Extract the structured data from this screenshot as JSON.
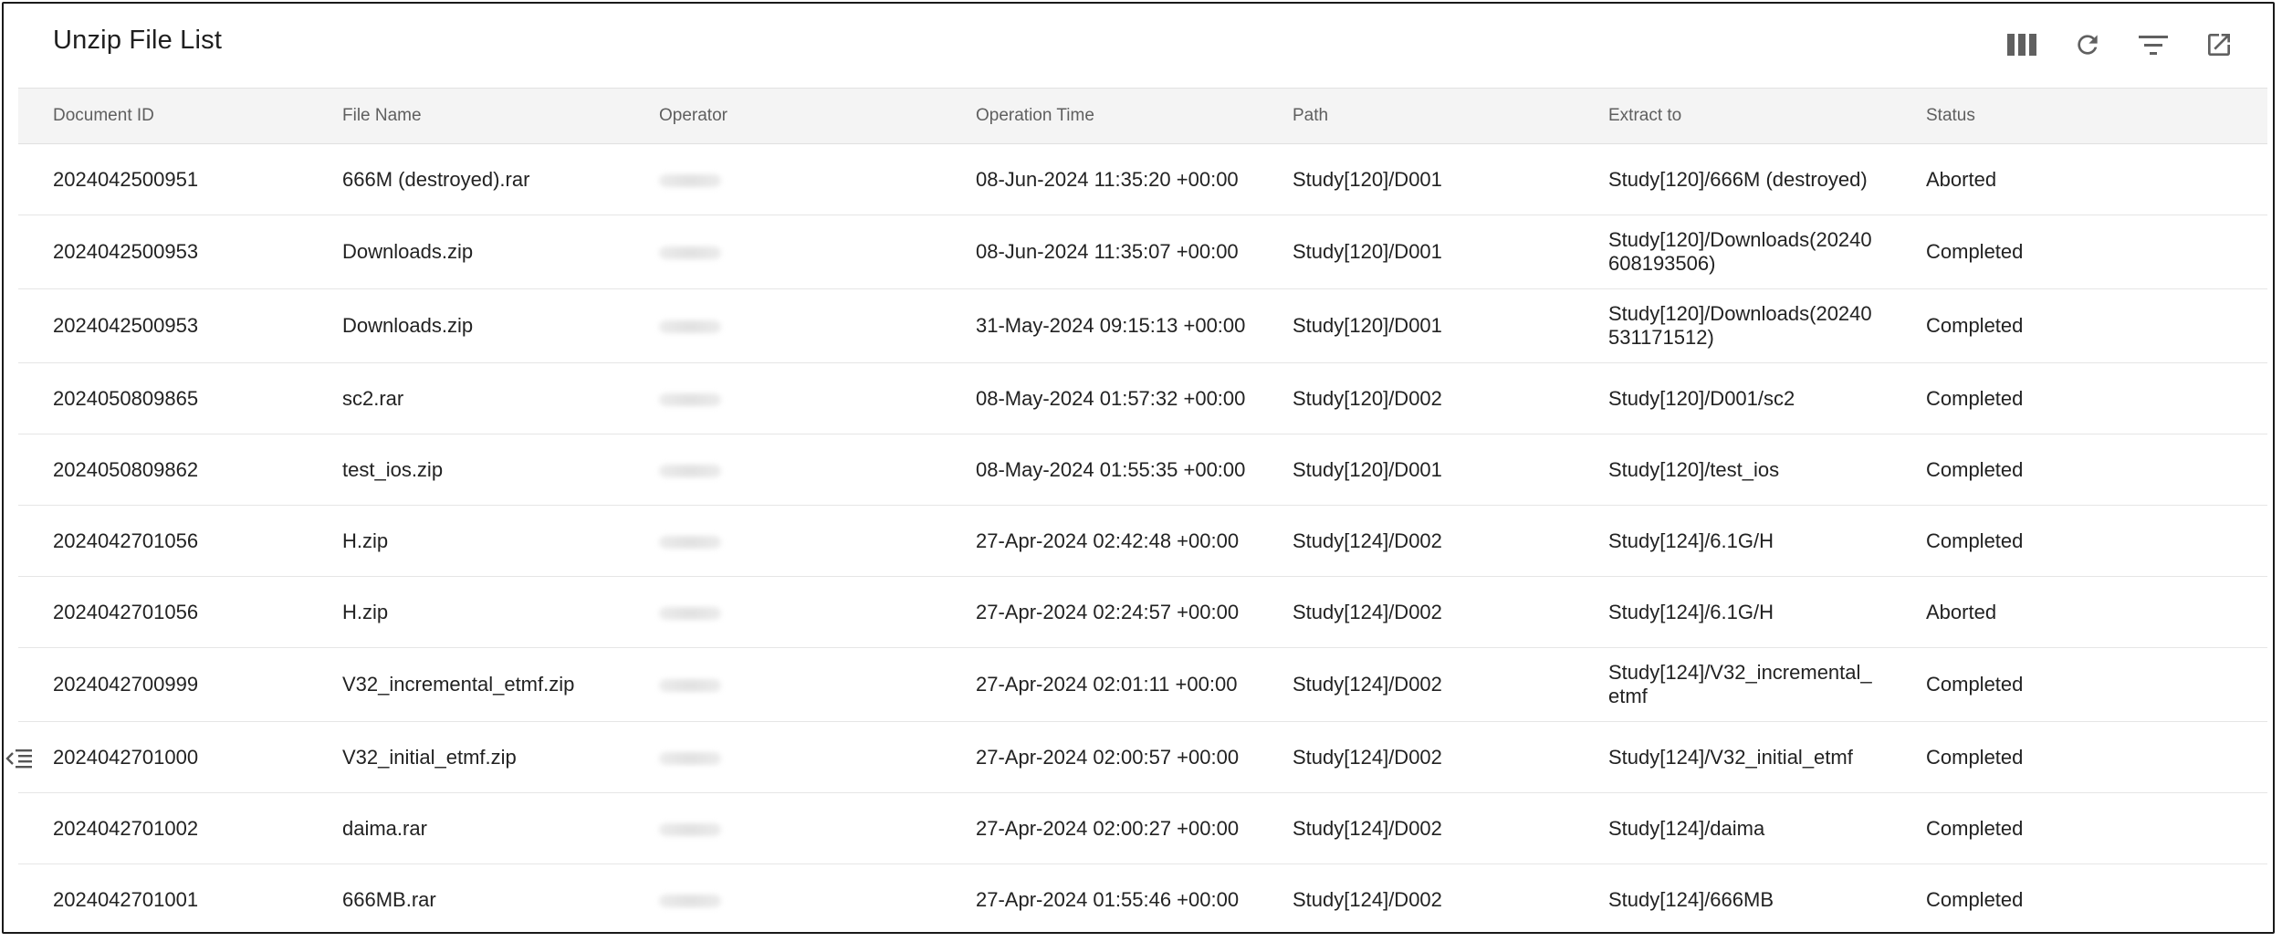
{
  "header": {
    "title": "Unzip File List"
  },
  "toolbar": {
    "icons": [
      "columns-icon",
      "refresh-icon",
      "filter-icon",
      "export-icon"
    ]
  },
  "table": {
    "columns": [
      "Document ID",
      "File Name",
      "Operator",
      "Operation Time",
      "Path",
      "Extract to",
      "Status"
    ],
    "rows": [
      {
        "document_id": "2024042500951",
        "file_name": "666M (destroyed).rar",
        "operator": "",
        "operation_time": "08-Jun-2024 11:35:20 +00:00",
        "path": "Study[120]/D001",
        "extract_to": "Study[120]/666M (destroyed)",
        "status": "Aborted"
      },
      {
        "document_id": "2024042500953",
        "file_name": "Downloads.zip",
        "operator": "",
        "operation_time": "08-Jun-2024 11:35:07 +00:00",
        "path": "Study[120]/D001",
        "extract_to": "Study[120]/Downloads(20240608193506)",
        "status": "Completed"
      },
      {
        "document_id": "2024042500953",
        "file_name": "Downloads.zip",
        "operator": "",
        "operation_time": "31-May-2024 09:15:13 +00:00",
        "path": "Study[120]/D001",
        "extract_to": "Study[120]/Downloads(20240531171512)",
        "status": "Completed"
      },
      {
        "document_id": "2024050809865",
        "file_name": "sc2.rar",
        "operator": "",
        "operation_time": "08-May-2024 01:57:32 +00:00",
        "path": "Study[120]/D002",
        "extract_to": "Study[120]/D001/sc2",
        "status": "Completed"
      },
      {
        "document_id": "2024050809862",
        "file_name": "test_ios.zip",
        "operator": "",
        "operation_time": "08-May-2024 01:55:35 +00:00",
        "path": "Study[120]/D001",
        "extract_to": "Study[120]/test_ios",
        "status": "Completed"
      },
      {
        "document_id": "2024042701056",
        "file_name": "H.zip",
        "operator": "",
        "operation_time": "27-Apr-2024 02:42:48 +00:00",
        "path": "Study[124]/D002",
        "extract_to": "Study[124]/6.1G/H",
        "status": "Completed"
      },
      {
        "document_id": "2024042701056",
        "file_name": "H.zip",
        "operator": "",
        "operation_time": "27-Apr-2024 02:24:57 +00:00",
        "path": "Study[124]/D002",
        "extract_to": "Study[124]/6.1G/H",
        "status": "Aborted"
      },
      {
        "document_id": "2024042700999",
        "file_name": "V32_incremental_etmf.zip",
        "operator": "",
        "operation_time": "27-Apr-2024 02:01:11 +00:00",
        "path": "Study[124]/D002",
        "extract_to": "Study[124]/V32_incremental_etmf",
        "status": "Completed"
      },
      {
        "document_id": "2024042701000",
        "file_name": "V32_initial_etmf.zip",
        "operator": "",
        "operation_time": "27-Apr-2024 02:00:57 +00:00",
        "path": "Study[124]/D002",
        "extract_to": "Study[124]/V32_initial_etmf",
        "status": "Completed"
      },
      {
        "document_id": "2024042701002",
        "file_name": "daima.rar",
        "operator": "",
        "operation_time": "27-Apr-2024 02:00:27 +00:00",
        "path": "Study[124]/D002",
        "extract_to": "Study[124]/daima",
        "status": "Completed"
      },
      {
        "document_id": "2024042701001",
        "file_name": "666MB.rar",
        "operator": "",
        "operation_time": "27-Apr-2024 01:55:46 +00:00",
        "path": "Study[124]/D002",
        "extract_to": "Study[124]/666MB",
        "status": "Completed"
      }
    ]
  },
  "sidebar_toggle": {
    "icon": "sidebar-toggle-icon"
  }
}
